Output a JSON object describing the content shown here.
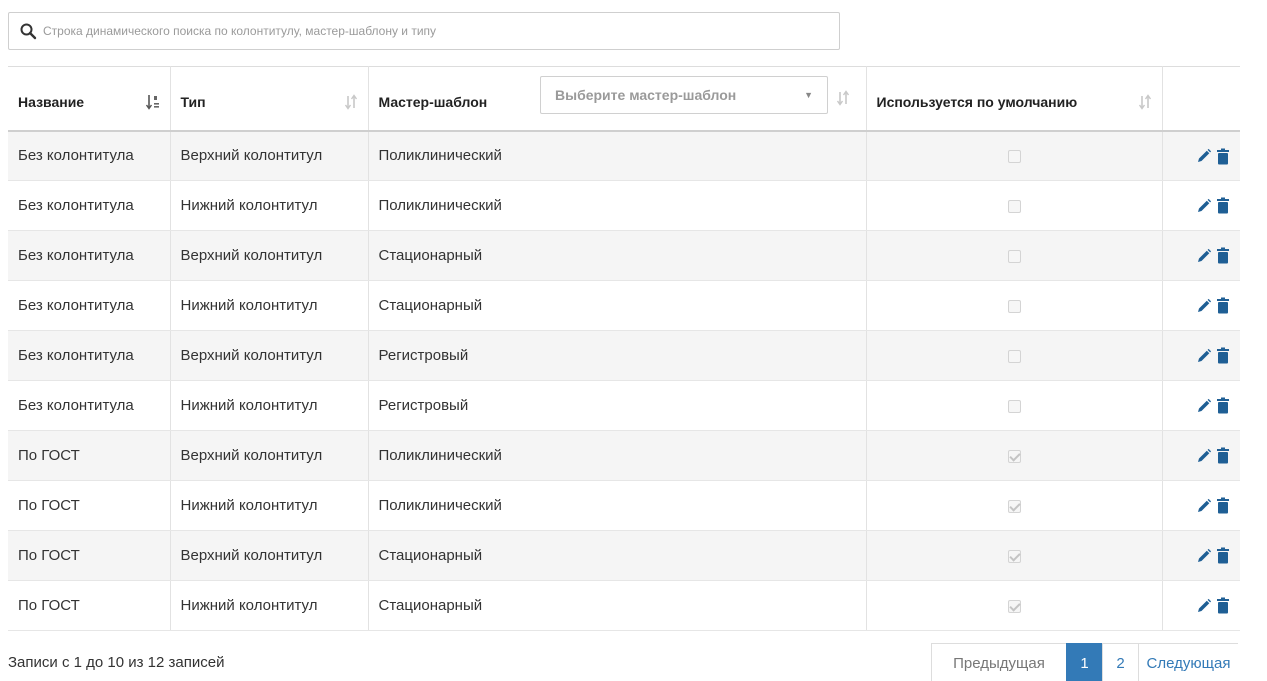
{
  "search": {
    "placeholder": "Строка динамического поиска по колонтитулу, мастер-шаблону и типу"
  },
  "table": {
    "columns": {
      "name": "Название",
      "type": "Тип",
      "master": "Мастер-шаблон",
      "default": "Используется по умолчанию"
    },
    "master_filter": {
      "placeholder": "Выберите мастер-шаблон"
    },
    "rows": [
      {
        "name": "Без колонтитула",
        "type": "Верхний колонтитул",
        "master": "Поликлинический",
        "default": false
      },
      {
        "name": "Без колонтитула",
        "type": "Нижний колонтитул",
        "master": "Поликлинический",
        "default": false
      },
      {
        "name": "Без колонтитула",
        "type": "Верхний колонтитул",
        "master": "Стационарный",
        "default": false
      },
      {
        "name": "Без колонтитула",
        "type": "Нижний колонтитул",
        "master": "Стационарный",
        "default": false
      },
      {
        "name": "Без колонтитула",
        "type": "Верхний колонтитул",
        "master": "Регистровый",
        "default": false
      },
      {
        "name": "Без колонтитула",
        "type": "Нижний колонтитул",
        "master": "Регистровый",
        "default": false
      },
      {
        "name": "По ГОСТ",
        "type": "Верхний колонтитул",
        "master": "Поликлинический",
        "default": true
      },
      {
        "name": "По ГОСТ",
        "type": "Нижний колонтитул",
        "master": "Поликлинический",
        "default": true
      },
      {
        "name": "По ГОСТ",
        "type": "Верхний колонтитул",
        "master": "Стационарный",
        "default": true
      },
      {
        "name": "По ГОСТ",
        "type": "Нижний колонтитул",
        "master": "Стационарный",
        "default": true
      }
    ]
  },
  "footer": {
    "info": "Записи с 1 до 10 из 12 записей"
  },
  "pagination": {
    "prev": "Предыдущая",
    "pages": [
      "1",
      "2"
    ],
    "current": "1",
    "next": "Следующая"
  },
  "icons": {
    "search": "search-icon",
    "sort_active": "sort-alpha-icon",
    "sort": "sort-icon",
    "edit": "pencil-icon",
    "delete": "trash-icon",
    "caret": "chevron-down-icon"
  },
  "colors": {
    "accent": "#337ab7",
    "row_stripe": "#f5f5f5"
  }
}
